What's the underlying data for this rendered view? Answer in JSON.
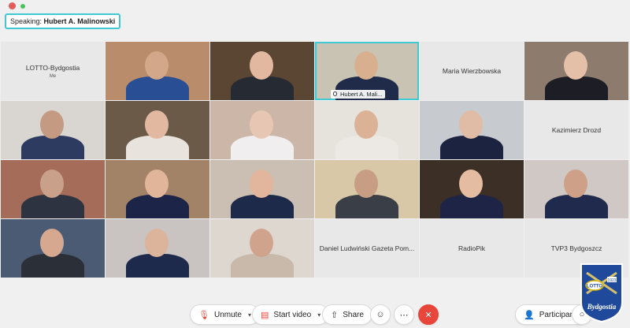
{
  "window": {
    "close_color": "#e35b5b",
    "max_color": "#4ac55a"
  },
  "speaking": {
    "prefix": "Speaking:",
    "name": "Hubert A. Malinowski"
  },
  "tiles": [
    {
      "name": "LOTTO-Bydgostia",
      "sub": "Me",
      "kind": "blank"
    },
    {
      "kind": "video",
      "bg": "#b98c6c",
      "skin": "#d2a78a",
      "shirt": "#2a4e93"
    },
    {
      "kind": "video",
      "bg": "#5b4633",
      "skin": "#e3b8a0",
      "shirt": "#262a33"
    },
    {
      "kind": "video",
      "bg": "#c9c3b4",
      "skin": "#d8b08f",
      "shirt": "#1f2b48",
      "tag": "Hubert A. Mali...",
      "active": true
    },
    {
      "name": "Maria Wierzbowska",
      "kind": "blank"
    },
    {
      "kind": "video",
      "bg": "#8d7c6d",
      "skin": "#e4c0a8",
      "shirt": "#1d1d26"
    },
    {
      "kind": "video",
      "bg": "#d9d5d0",
      "skin": "#c59a83",
      "shirt": "#2d3b60"
    },
    {
      "kind": "video",
      "bg": "#6b5a48",
      "skin": "#e2b9a0",
      "shirt": "#e8e3dc"
    },
    {
      "kind": "video",
      "bg": "#cbb6a8",
      "skin": "#e7c7b4",
      "shirt": "#f0eeee"
    },
    {
      "kind": "video",
      "bg": "#e6e2dc",
      "skin": "#dcb297",
      "shirt": "#ece8e4"
    },
    {
      "kind": "video",
      "bg": "#c7cbcf",
      "skin": "#e0bca6",
      "shirt": "#1b2340"
    },
    {
      "name": "Kazimierz Drozd",
      "kind": "blank"
    },
    {
      "kind": "video",
      "bg": "#a56d59",
      "skin": "#c9a08a",
      "shirt": "#2d3340"
    },
    {
      "kind": "video",
      "bg": "#a38367",
      "skin": "#e0b59a",
      "shirt": "#1c2448"
    },
    {
      "kind": "video",
      "bg": "#cabfb2",
      "skin": "#e1b69c",
      "shirt": "#1e2a4a"
    },
    {
      "kind": "video",
      "bg": "#d8c8a8",
      "skin": "#c79e83",
      "shirt": "#3a3e46"
    },
    {
      "kind": "video",
      "bg": "#3c3026",
      "skin": "#e3bca2",
      "shirt": "#1d2446"
    },
    {
      "kind": "video",
      "bg": "#cfc8c4",
      "skin": "#cfa088",
      "shirt": "#1f2a4c"
    },
    {
      "kind": "video",
      "bg": "#4c5b74",
      "skin": "#d6a88f",
      "shirt": "#2b2f38"
    },
    {
      "kind": "video",
      "bg": "#c9c4c2",
      "skin": "#dcb49c",
      "shirt": "#1d2a4c"
    },
    {
      "kind": "video",
      "bg": "#ddd7cf",
      "skin": "#cfa38c",
      "shirt": "#c9b9aa"
    },
    {
      "name": "Daniel Ludwiński Gazeta Pom...",
      "kind": "blank"
    },
    {
      "name": "RadioPik",
      "kind": "blank"
    },
    {
      "name": "TVP3 Bydgoszcz",
      "kind": "blank"
    }
  ],
  "toolbar": {
    "unmute": "Unmute",
    "start_video": "Start video",
    "share": "Share",
    "reactions_icon": "smiley-icon",
    "more_icon": "more-icon",
    "end_icon": "close-icon",
    "participants": "Participants",
    "end_color": "#e8463b"
  },
  "crest": {
    "text": "Bydgostia",
    "logo": "LOTTO",
    "year": "1923"
  }
}
